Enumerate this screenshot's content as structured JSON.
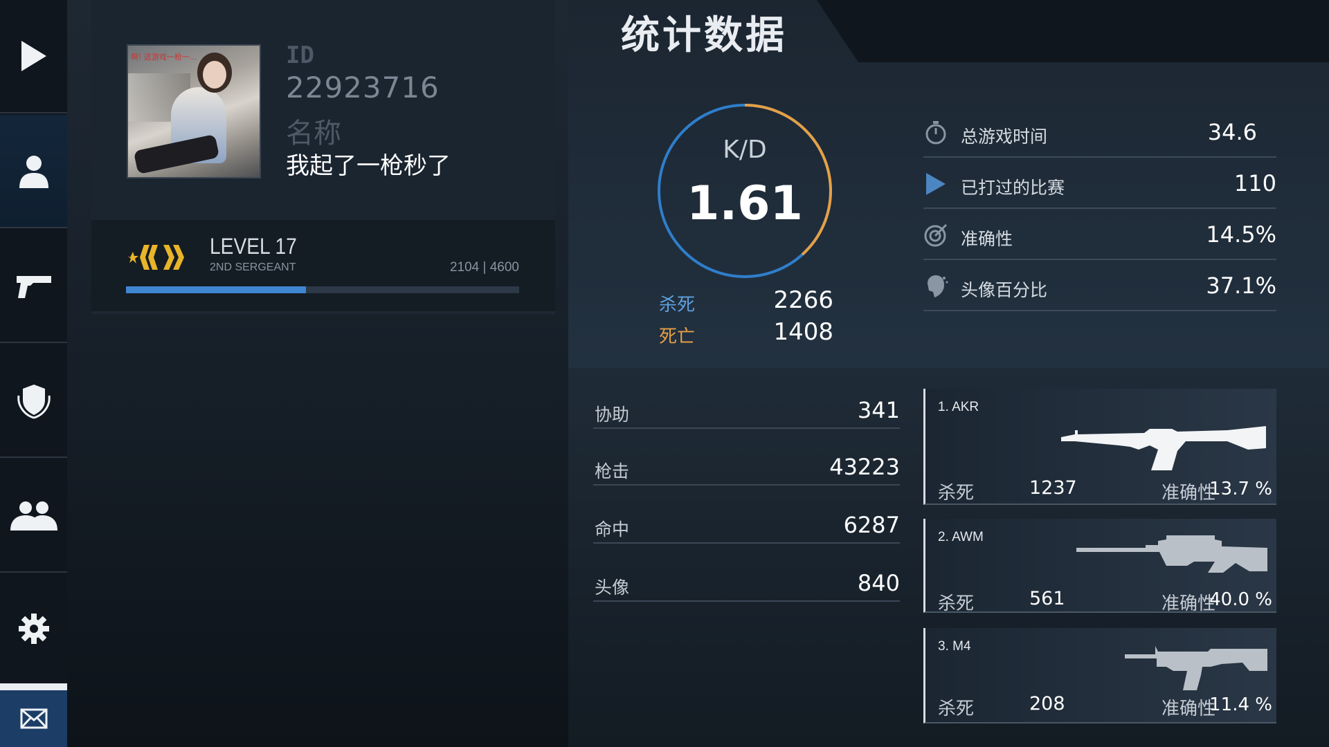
{
  "title": "统计数据",
  "profile": {
    "id_label": "ID",
    "id": "22923716",
    "name_label": "名称",
    "name": "我起了一枪秒了",
    "avatar_caption": "啊! 这游戏一枪一...",
    "level": "LEVEL 17",
    "rank": "2ND SERGEANT",
    "xp": "2104 | 4600",
    "xp_progress": 0.457
  },
  "kd": {
    "label": "K/D",
    "value": "1.61",
    "kills_label": "杀死",
    "kills": "2266",
    "deaths_label": "死亡",
    "deaths": "1408",
    "kill_fraction": 0.617
  },
  "stats": [
    {
      "icon": "stopwatch-icon",
      "label": "总游戏时间",
      "value": "34.6"
    },
    {
      "icon": "play-icon",
      "label": "已打过的比赛",
      "value": "110"
    },
    {
      "icon": "target-icon",
      "label": "准确性",
      "value": "14.5%"
    },
    {
      "icon": "headshot-icon",
      "label": "头像百分比",
      "value": "37.1%"
    }
  ],
  "details": [
    {
      "label": "协助",
      "value": "341"
    },
    {
      "label": "枪击",
      "value": "43223"
    },
    {
      "label": "命中",
      "value": "6287"
    },
    {
      "label": "头像",
      "value": "840"
    }
  ],
  "weapons": [
    {
      "name": "1. AKR",
      "kills_label": "杀死",
      "kills": "1237",
      "acc_label": "准确性",
      "acc": "13.7 %"
    },
    {
      "name": "2. AWM",
      "kills_label": "杀死",
      "kills": "561",
      "acc_label": "准确性",
      "acc": "40.0 %"
    },
    {
      "name": "3. M4",
      "kills_label": "杀死",
      "kills": "208",
      "acc_label": "准确性",
      "acc": "11.4 %"
    }
  ],
  "colors": {
    "accent_blue": "#3f86d0",
    "kills_blue": "#5ea2e0",
    "deaths_orange": "#e5a046",
    "rank_gold": "#e8b429"
  },
  "sidebar": [
    "play-icon",
    "profile-icon",
    "pistol-icon",
    "clan-shield-icon",
    "friends-icon",
    "settings-gear-icon",
    "mail-icon"
  ]
}
